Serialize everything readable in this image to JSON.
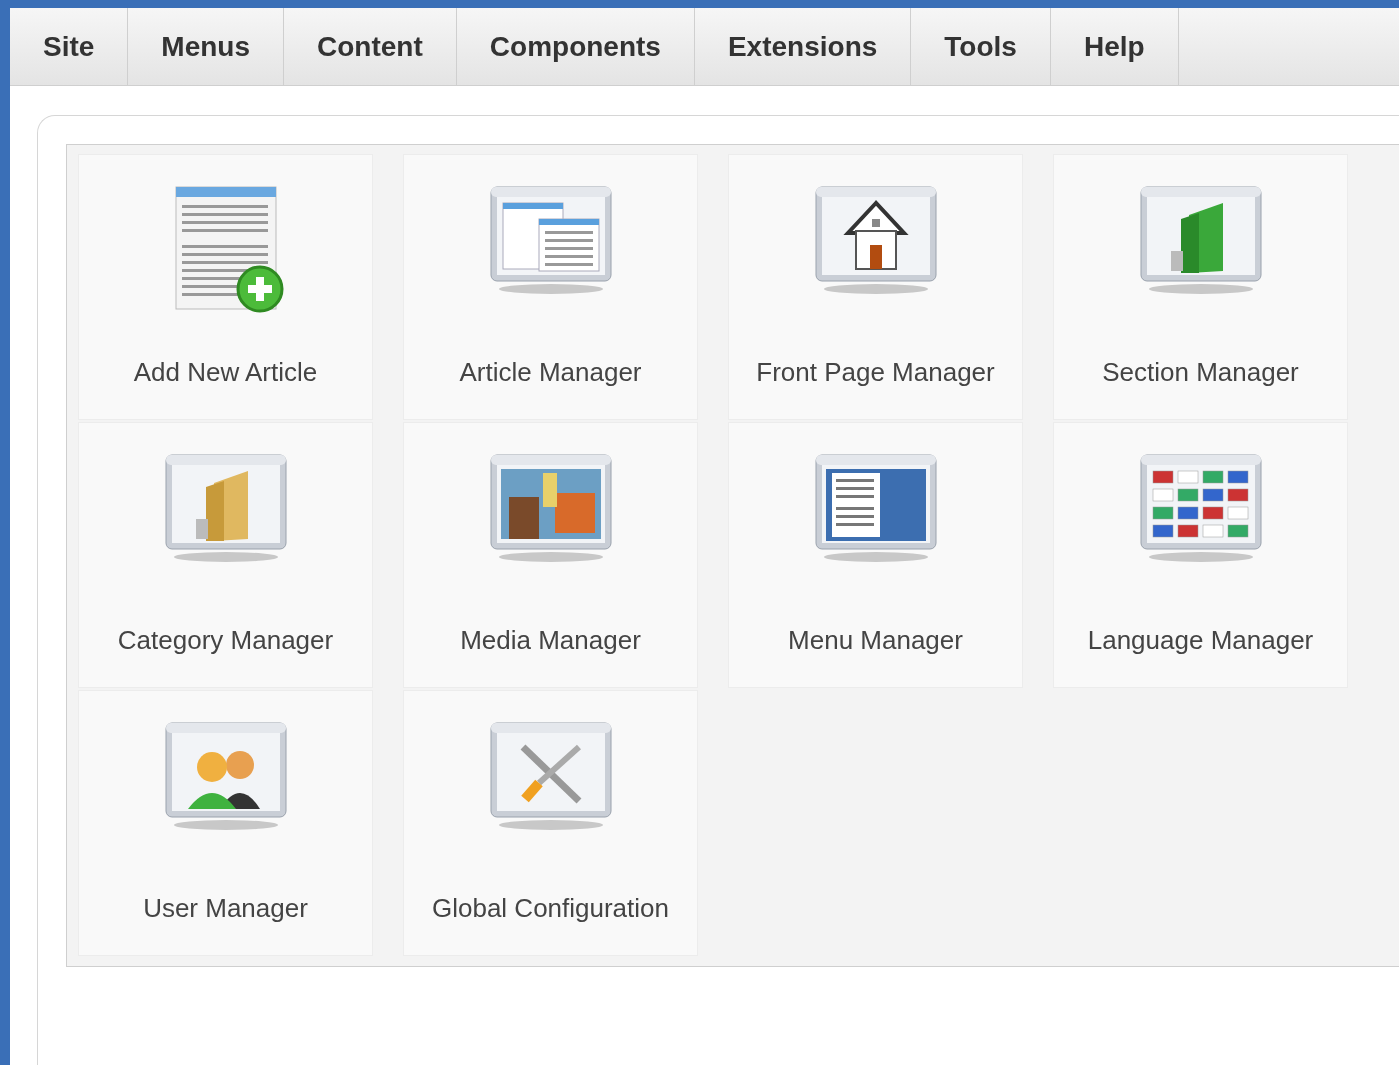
{
  "menu": [
    {
      "label": "Site"
    },
    {
      "label": "Menus"
    },
    {
      "label": "Content"
    },
    {
      "label": "Components"
    },
    {
      "label": "Extensions"
    },
    {
      "label": "Tools"
    },
    {
      "label": "Help"
    }
  ],
  "shortcuts": [
    {
      "label": "Add New Article",
      "kind": "document"
    },
    {
      "label": "Article Manager",
      "kind": "articles"
    },
    {
      "label": "Front Page Manager",
      "kind": "home"
    },
    {
      "label": "Section Manager",
      "kind": "section"
    },
    {
      "label": "Category Manager",
      "kind": "folder"
    },
    {
      "label": "Media Manager",
      "kind": "media"
    },
    {
      "label": "Menu Manager",
      "kind": "menu"
    },
    {
      "label": "Language Manager",
      "kind": "flags"
    },
    {
      "label": "User Manager",
      "kind": "users"
    },
    {
      "label": "Global Configuration",
      "kind": "tools"
    }
  ]
}
